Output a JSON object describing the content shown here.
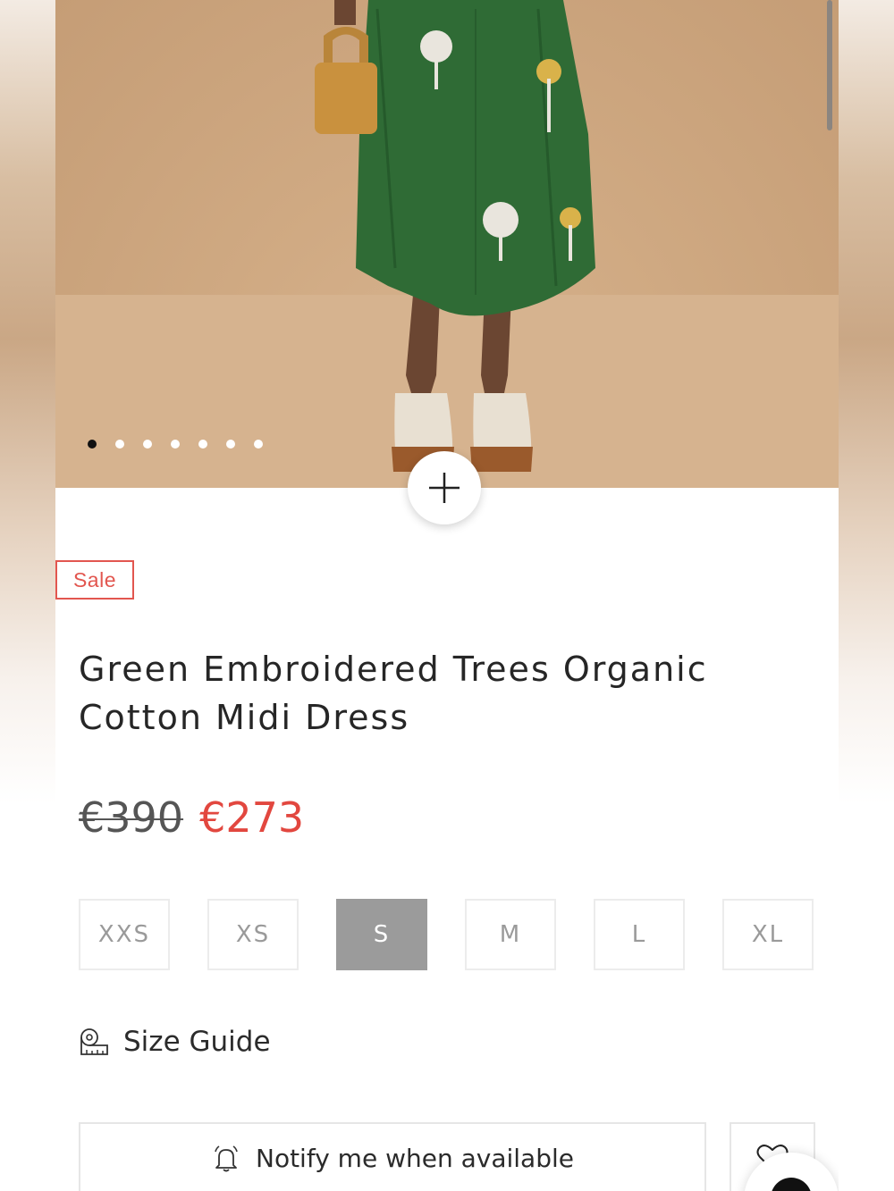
{
  "gallery": {
    "dots_total": 7,
    "active_dot": 0,
    "zoom_label": "+"
  },
  "product": {
    "badge": "Sale",
    "title_line1": "Green Embroidered Trees Organic",
    "title_line2": "Cotton Midi Dress",
    "old_price": "€390",
    "new_price": "€273"
  },
  "sizes": {
    "options": [
      "XXS",
      "XS",
      "S",
      "M",
      "L",
      "XL"
    ],
    "selected": "S"
  },
  "size_guide": {
    "label": "Size Guide",
    "icon": "measuring-tape-icon"
  },
  "actions": {
    "notify_label": "Notify me when available",
    "notify_icon": "bell-icon",
    "wishlist_icon": "heart-icon"
  },
  "colors": {
    "sale_red": "#e2564f",
    "price_red": "#e2473f",
    "selected_size_bg": "#9b9b9b",
    "dress_green": "#2f6b35"
  }
}
